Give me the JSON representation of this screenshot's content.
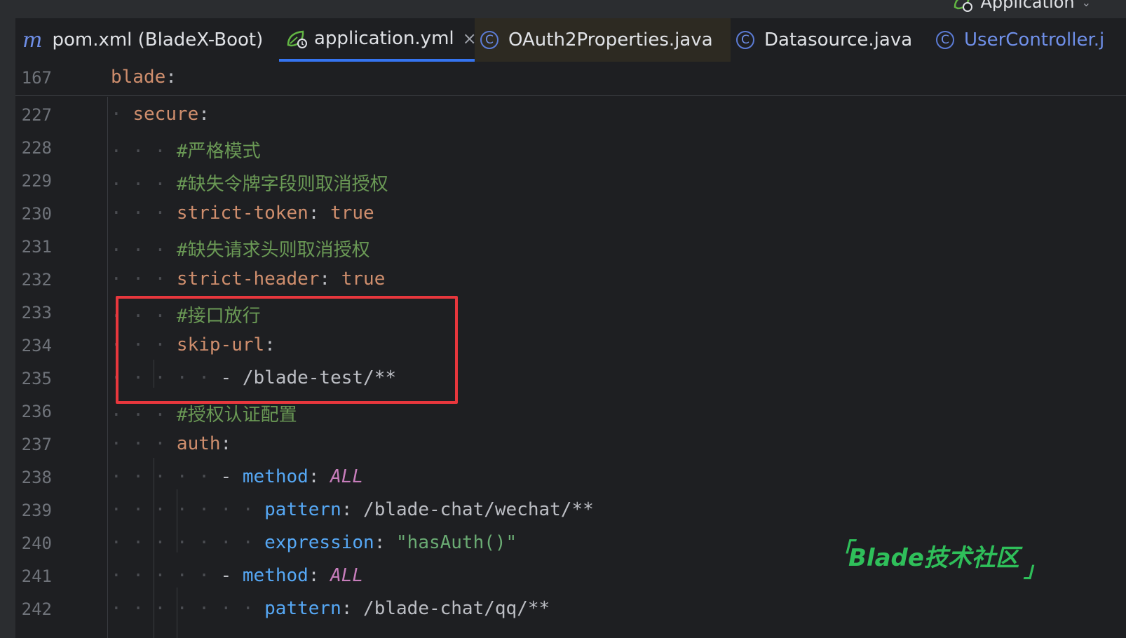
{
  "run_config": {
    "label": "Application",
    "icon": "spring-boot-run-icon"
  },
  "tabs": [
    {
      "label": "pom.xml (BladeX-Boot)",
      "icon": "maven-icon",
      "icon_glyph": "m"
    },
    {
      "label": "application.yml",
      "icon": "spring-yaml-icon",
      "close": "×"
    },
    {
      "label": "OAuth2Properties.java",
      "icon": "class-icon",
      "icon_glyph": "C"
    },
    {
      "label": "Datasource.java",
      "icon": "class-icon",
      "icon_glyph": "C"
    },
    {
      "label": "UserController.j",
      "icon": "class-icon",
      "icon_glyph": "C"
    }
  ],
  "sticky": {
    "line": "167",
    "key": "blade",
    "colon": ":"
  },
  "lines": [
    {
      "num": "227",
      "dots": "· ",
      "key": "secure",
      "colon": ":"
    },
    {
      "num": "228",
      "dots": "· · · ",
      "comment": "#严格模式"
    },
    {
      "num": "229",
      "dots": "· · · ",
      "comment": "#缺失令牌字段则取消授权"
    },
    {
      "num": "230",
      "dots": "· · · ",
      "key": "strict-token",
      "colon": ":",
      "sep": " ",
      "value": "true"
    },
    {
      "num": "231",
      "dots": "· · · ",
      "comment": "#缺失请求头则取消授权"
    },
    {
      "num": "232",
      "dots": "· · · ",
      "key": "strict-header",
      "colon": ":",
      "sep": " ",
      "value": "true"
    },
    {
      "num": "233",
      "dots": "· · · ",
      "comment": "#接口放行"
    },
    {
      "num": "234",
      "dots": "· · · ",
      "key": "skip-url",
      "colon": ":"
    },
    {
      "num": "235",
      "dots": "· · · · · ",
      "dash": "- ",
      "plain": "/blade-test/**"
    },
    {
      "num": "236",
      "dots": "· · · ",
      "comment": "#授权认证配置"
    },
    {
      "num": "237",
      "dots": "· · · ",
      "key": "auth",
      "colon": ":"
    },
    {
      "num": "238",
      "dots": "· · · · · ",
      "dash": "- ",
      "bkey": "method",
      "colon": ":",
      "sep": " ",
      "ital": "ALL"
    },
    {
      "num": "239",
      "dots": "· · · · · · · ",
      "bkey": "pattern",
      "colon": ":",
      "sep": " ",
      "plain": "/blade-chat/wechat/**"
    },
    {
      "num": "240",
      "dots": "· · · · · · · ",
      "bkey": "expression",
      "colon": ":",
      "sep": " ",
      "str": "\"hasAuth()\""
    },
    {
      "num": "241",
      "dots": "· · · · · ",
      "dash": "- ",
      "bkey": "method",
      "colon": ":",
      "sep": " ",
      "ital": "ALL"
    },
    {
      "num": "242",
      "dots": "· · · · · · · ",
      "bkey": "pattern",
      "colon": ":",
      "sep": " ",
      "plain": "/blade-chat/qq/**"
    }
  ],
  "watermark": {
    "open": "「",
    "text": "Blade技术社区",
    "close": "」"
  },
  "colors": {
    "keyword": "#cf8e6d",
    "comment": "#6a9955",
    "blue_key": "#56a8f5",
    "italic": "#c77dbb",
    "string": "#6aab73",
    "highlight": "#e8373d",
    "accent": "#3574f0"
  }
}
